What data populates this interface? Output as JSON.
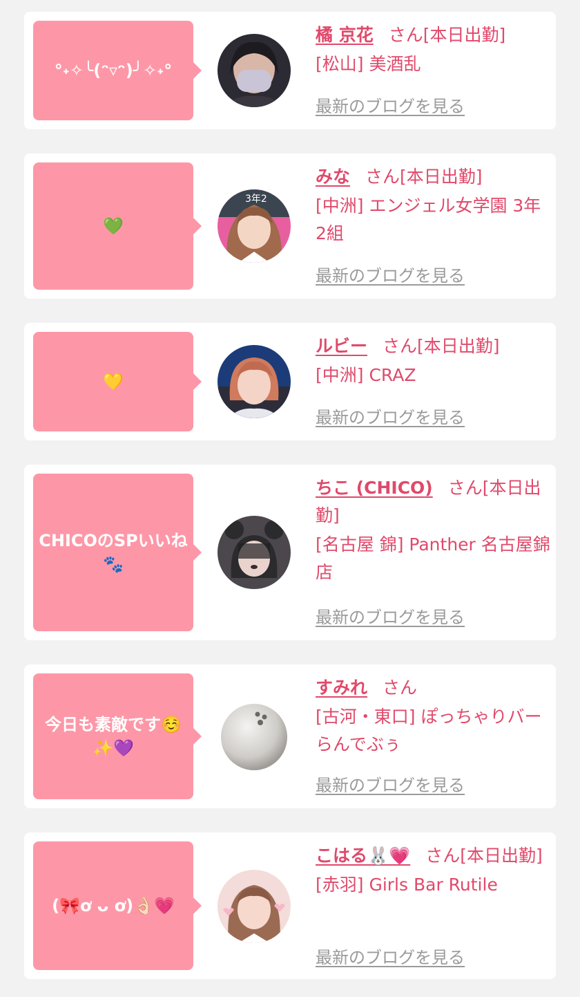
{
  "cards": [
    {
      "comment": "°˖✧╰(ᵔ▿ᵔ)╯✧˖°",
      "name": "橘 京花",
      "san": "さん",
      "status": "[本日出勤]",
      "shop": "[松山] 美酒乱",
      "blog": "最新のブログを見る",
      "avatar_colors": [
        "#2c2a33",
        "#6a6174",
        "#c9c4d6"
      ]
    },
    {
      "comment": "💚",
      "name": "みな",
      "san": "さん",
      "status": "[本日出勤]",
      "shop": "[中洲] エンジェル女学園 3年2組",
      "blog": "最新のブログを見る",
      "avatar_colors": [
        "#e85fa0",
        "#a16a4d",
        "#f4d6c4"
      ]
    },
    {
      "comment": "💛",
      "name": "ルビー",
      "san": "さん",
      "status": "[本日出勤]",
      "shop": "[中洲] CRAZ",
      "blog": "最新のブログを見る",
      "avatar_colors": [
        "#1b3c78",
        "#d07a5e",
        "#f3d4c7"
      ]
    },
    {
      "comment": "CHICOのSPいいね🐾",
      "name": "ちこ (CHICO)",
      "san": "さん",
      "status": "[本日出勤]",
      "shop": "[名古屋 錦] Panther 名古屋錦店",
      "blog": "最新のブログを見る",
      "avatar_colors": [
        "#2b2a2d",
        "#4b474c",
        "#ead3cd"
      ]
    },
    {
      "comment": "今日も素敵です☺️✨💜",
      "name": "すみれ",
      "san": "さん",
      "status": "",
      "shop": "[古河・東口] ぽっちゃりバー らんでぶぅ",
      "blog": "最新のブログを見る",
      "avatar_colors": [
        "#ffffff",
        "#d8d6d3",
        "#9f9c98"
      ]
    },
    {
      "comment": "(🎀ơ ᴗ ơ)👌🏻💗",
      "name": "こはる🐰💗",
      "san": "さん",
      "status": "[本日出勤]",
      "shop": "[赤羽] Girls Bar Rutile",
      "blog": "最新のブログを見る",
      "avatar_colors": [
        "#f3dcd9",
        "#9b6a52",
        "#f6d8cd"
      ]
    }
  ]
}
